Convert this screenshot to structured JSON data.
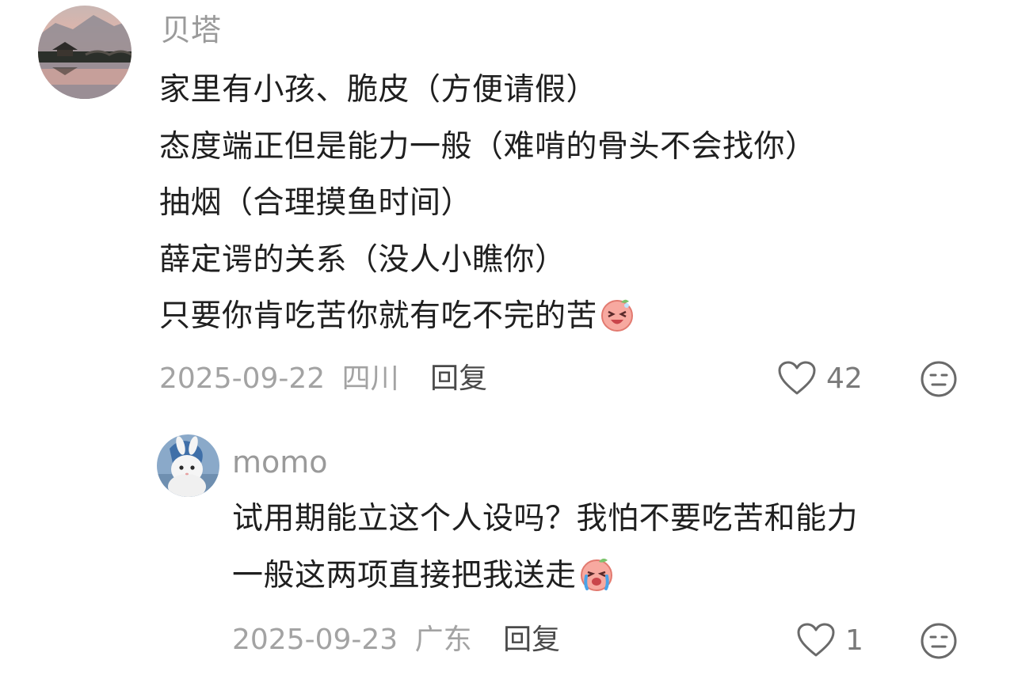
{
  "comments": [
    {
      "username": "贝塔",
      "lines": [
        "家里有小孩、脆皮（方便请假）",
        "态度端正但是能力一般（难啃的骨头不会找你）",
        "抽烟（合理摸鱼时间）",
        "薛定谔的关系（没人小瞧你）",
        "只要你肯吃苦你就有吃不完的苦"
      ],
      "sticker": "laughing-peach-sticker",
      "date": "2025-09-22",
      "location": "四川",
      "reply_label": "回复",
      "likes": "42"
    },
    {
      "username": "momo",
      "lines": [
        "试用期能立这个人设吗？我怕不要吃苦和能力",
        "一般这两项直接把我送走"
      ],
      "sticker": "crying-peach-sticker",
      "date": "2025-09-23",
      "location": "广东",
      "reply_label": "回复",
      "likes": "1"
    }
  ],
  "icons": {
    "like": "heart-outline-icon",
    "dislike": "meh-face-icon"
  },
  "colors": {
    "text": "#1f1f1f",
    "meta": "#a3a3a3",
    "reply": "#4a4a4a"
  }
}
